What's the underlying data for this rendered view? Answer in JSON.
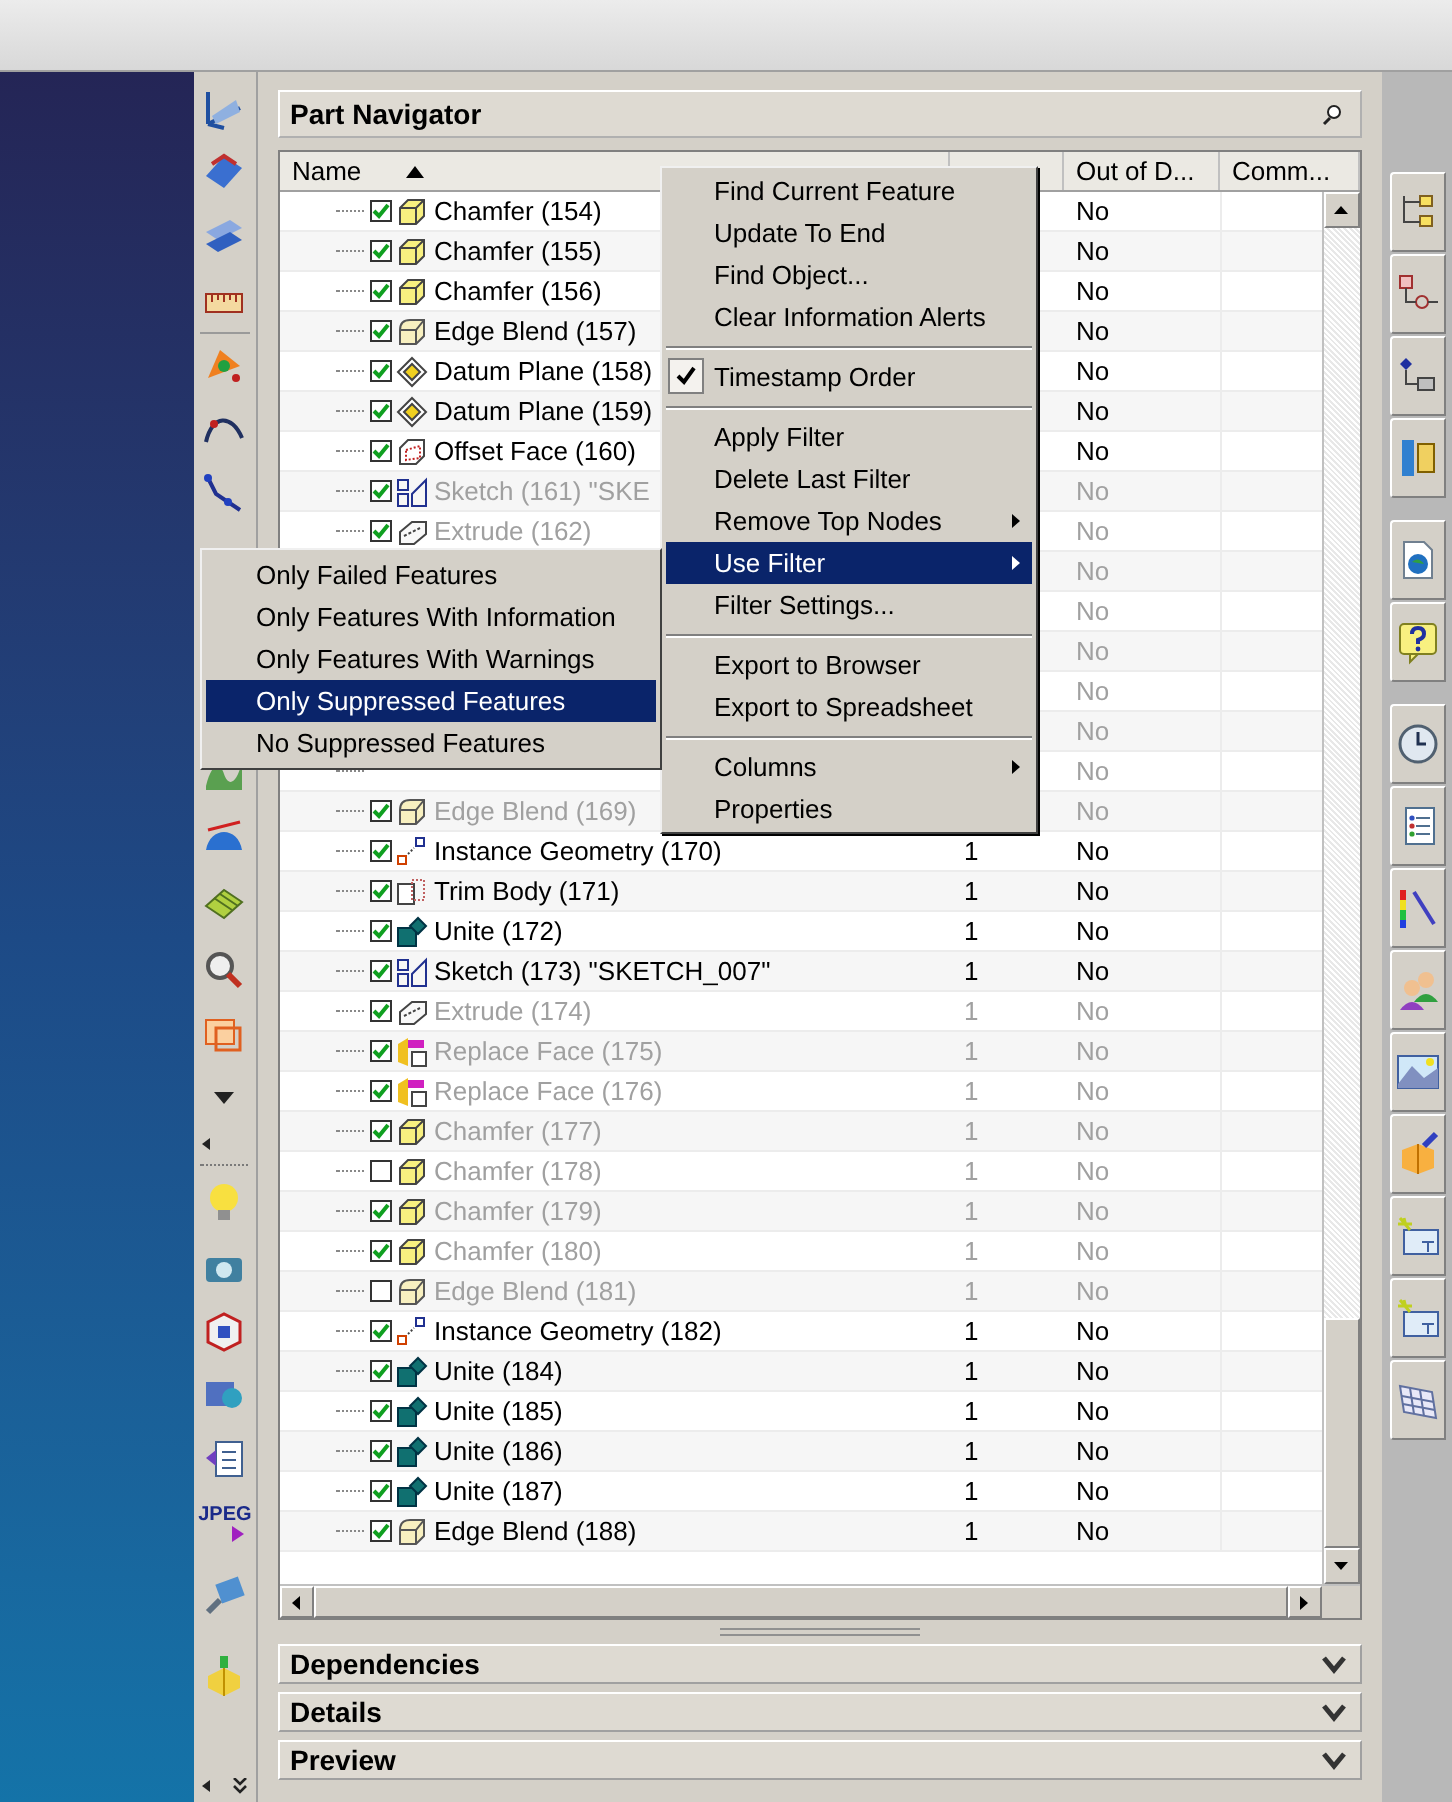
{
  "panel": {
    "title": "Part Navigator"
  },
  "columns": [
    {
      "label": "Name",
      "sorted": true
    },
    {
      "label": "Out of D..."
    },
    {
      "label": "Comm..."
    }
  ],
  "rows": [
    {
      "name": "Chamfer (154)",
      "kind": "chamfer",
      "checked": true,
      "suppressed": false,
      "out_of_date": "No"
    },
    {
      "name": "Chamfer (155)",
      "kind": "chamfer",
      "checked": true,
      "suppressed": false,
      "out_of_date": "No"
    },
    {
      "name": "Chamfer (156)",
      "kind": "chamfer",
      "checked": true,
      "suppressed": false,
      "out_of_date": "No"
    },
    {
      "name": "Edge Blend (157)",
      "kind": "blend",
      "checked": true,
      "suppressed": false,
      "out_of_date": "No"
    },
    {
      "name": "Datum Plane (158)",
      "kind": "datum",
      "checked": true,
      "suppressed": false,
      "out_of_date": "No"
    },
    {
      "name": "Datum Plane (159)",
      "kind": "datum",
      "checked": true,
      "suppressed": false,
      "out_of_date": "No"
    },
    {
      "name": "Offset Face (160)",
      "kind": "offset",
      "checked": true,
      "suppressed": false,
      "out_of_date": "No"
    },
    {
      "name": "Sketch (161) \"SKE",
      "kind": "sketch",
      "checked": true,
      "suppressed": true,
      "out_of_date": "No"
    },
    {
      "name": "Extrude (162)",
      "kind": "extrude",
      "checked": true,
      "suppressed": true,
      "out_of_date": "No"
    },
    {
      "kind": "hidden",
      "suppressed": true,
      "out_of_date": "No"
    },
    {
      "kind": "hidden",
      "suppressed": true,
      "out_of_date": "No"
    },
    {
      "kind": "hidden",
      "suppressed": true,
      "out_of_date": "No"
    },
    {
      "kind": "hidden",
      "suppressed": true,
      "out_of_date": "No"
    },
    {
      "kind": "hidden",
      "suppressed": true,
      "out_of_date": "No"
    },
    {
      "kind": "hidden",
      "suppressed": true,
      "out_of_date": "No"
    },
    {
      "name": "Edge Blend (169)",
      "kind": "blend",
      "checked": true,
      "suppressed": true,
      "out_of_date": "No"
    },
    {
      "name": "Instance Geometry (170)",
      "kind": "instance",
      "checked": true,
      "suppressed": false,
      "layer": "1",
      "out_of_date": "No"
    },
    {
      "name": "Trim Body (171)",
      "kind": "trim",
      "checked": true,
      "suppressed": false,
      "layer": "1",
      "out_of_date": "No"
    },
    {
      "name": "Unite (172)",
      "kind": "unite",
      "checked": true,
      "suppressed": false,
      "layer": "1",
      "out_of_date": "No"
    },
    {
      "name": "Sketch (173) \"SKETCH_007\"",
      "kind": "sketch",
      "checked": true,
      "suppressed": false,
      "layer": "1",
      "out_of_date": "No"
    },
    {
      "name": "Extrude (174)",
      "kind": "extrude",
      "checked": true,
      "suppressed": true,
      "layer": "1",
      "out_of_date": "No"
    },
    {
      "name": "Replace Face (175)",
      "kind": "replace",
      "checked": true,
      "suppressed": true,
      "layer": "1",
      "out_of_date": "No"
    },
    {
      "name": "Replace Face (176)",
      "kind": "replace",
      "checked": true,
      "suppressed": true,
      "layer": "1",
      "out_of_date": "No"
    },
    {
      "name": "Chamfer (177)",
      "kind": "chamfer",
      "checked": true,
      "suppressed": true,
      "layer": "1",
      "out_of_date": "No"
    },
    {
      "name": "Chamfer (178)",
      "kind": "chamfer",
      "checked": false,
      "suppressed": true,
      "layer": "1",
      "out_of_date": "No"
    },
    {
      "name": "Chamfer (179)",
      "kind": "chamfer",
      "checked": true,
      "suppressed": true,
      "layer": "1",
      "out_of_date": "No"
    },
    {
      "name": "Chamfer (180)",
      "kind": "chamfer",
      "checked": true,
      "suppressed": true,
      "layer": "1",
      "out_of_date": "No"
    },
    {
      "name": "Edge Blend (181)",
      "kind": "blend",
      "checked": false,
      "suppressed": true,
      "layer": "1",
      "out_of_date": "No"
    },
    {
      "name": "Instance Geometry (182)",
      "kind": "instance",
      "checked": true,
      "suppressed": false,
      "layer": "1",
      "out_of_date": "No"
    },
    {
      "name": "Unite (184)",
      "kind": "unite",
      "checked": true,
      "suppressed": false,
      "layer": "1",
      "out_of_date": "No"
    },
    {
      "name": "Unite (185)",
      "kind": "unite",
      "checked": true,
      "suppressed": false,
      "layer": "1",
      "out_of_date": "No"
    },
    {
      "name": "Unite (186)",
      "kind": "unite",
      "checked": true,
      "suppressed": false,
      "layer": "1",
      "out_of_date": "No"
    },
    {
      "name": "Unite (187)",
      "kind": "unite",
      "checked": true,
      "suppressed": false,
      "layer": "1",
      "out_of_date": "No"
    },
    {
      "name": "Edge Blend (188)",
      "kind": "blend",
      "checked": true,
      "suppressed": false,
      "layer": "1",
      "out_of_date": "No"
    }
  ],
  "sections": [
    {
      "label": "Dependencies",
      "expanded": false
    },
    {
      "label": "Details",
      "expanded": false
    },
    {
      "label": "Preview",
      "expanded": false
    }
  ],
  "context_menu": [
    {
      "kind": "item",
      "label": "Find Current Feature",
      "selected": false
    },
    {
      "kind": "item",
      "label": "Update To End",
      "selected": false
    },
    {
      "kind": "item",
      "label": "Find Object...",
      "selected": false
    },
    {
      "kind": "item",
      "label": "Clear Information Alerts",
      "selected": false
    },
    {
      "kind": "separator"
    },
    {
      "kind": "check",
      "label": "Timestamp Order",
      "checked": true,
      "selected": false
    },
    {
      "kind": "separator"
    },
    {
      "kind": "item",
      "label": "Apply Filter",
      "selected": false
    },
    {
      "kind": "item",
      "label": "Delete Last Filter",
      "selected": false
    },
    {
      "kind": "submenu",
      "label": "Remove Top Nodes",
      "selected": false
    },
    {
      "kind": "submenu",
      "label": "Use Filter",
      "selected": true
    },
    {
      "kind": "item",
      "label": "Filter Settings...",
      "selected": false
    },
    {
      "kind": "separator"
    },
    {
      "kind": "item",
      "label": "Export to Browser",
      "selected": false
    },
    {
      "kind": "item",
      "label": "Export to Spreadsheet",
      "selected": false
    },
    {
      "kind": "separator"
    },
    {
      "kind": "submenu",
      "label": "Columns",
      "selected": false
    },
    {
      "kind": "item",
      "label": "Properties",
      "selected": false
    }
  ],
  "filter_submenu": [
    {
      "label": "Only Failed Features",
      "selected": false
    },
    {
      "label": "Only Features With Information",
      "selected": false
    },
    {
      "label": "Only Features With Warnings",
      "selected": false
    },
    {
      "label": "Only Suppressed Features",
      "selected": true
    },
    {
      "label": "No Suppressed Features",
      "selected": false
    }
  ],
  "left_toolbar": {
    "jpeg_label": "JPEG"
  }
}
